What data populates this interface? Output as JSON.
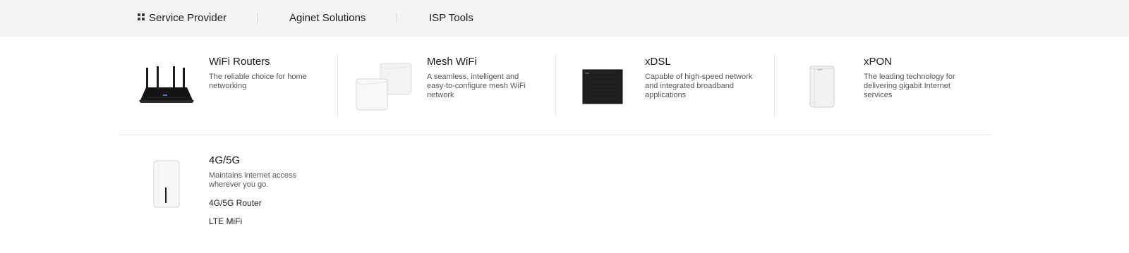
{
  "nav": {
    "service_provider": "Service Provider",
    "aginet_solutions": "Aginet Solutions",
    "isp_tools": "ISP Tools"
  },
  "products": {
    "wifi_routers": {
      "title": "WiFi Routers",
      "desc": "The reliable choice for home networking"
    },
    "mesh_wifi": {
      "title": "Mesh WiFi",
      "desc": "A seamless, intelligent and easy-to-configure mesh WiFi network"
    },
    "xdsl": {
      "title": "xDSL",
      "desc": "Capable of high-speed network and integrated broadband applications"
    },
    "xpon": {
      "title": "xPON",
      "desc": "The leading technology for delivering gigabit Internet services"
    },
    "fourg_fiveg": {
      "title": "4G/5G",
      "desc": "Maintains internet access wherever you go.",
      "links": [
        "4G/5G Router",
        "LTE MiFi"
      ]
    }
  },
  "colors": {
    "topbar_bg": "#f4f5f6",
    "text": "#1a1a1a",
    "desc_text": "#555555",
    "divider": "#e6e7e9"
  },
  "icons": {
    "service_provider": "grid-icon"
  }
}
